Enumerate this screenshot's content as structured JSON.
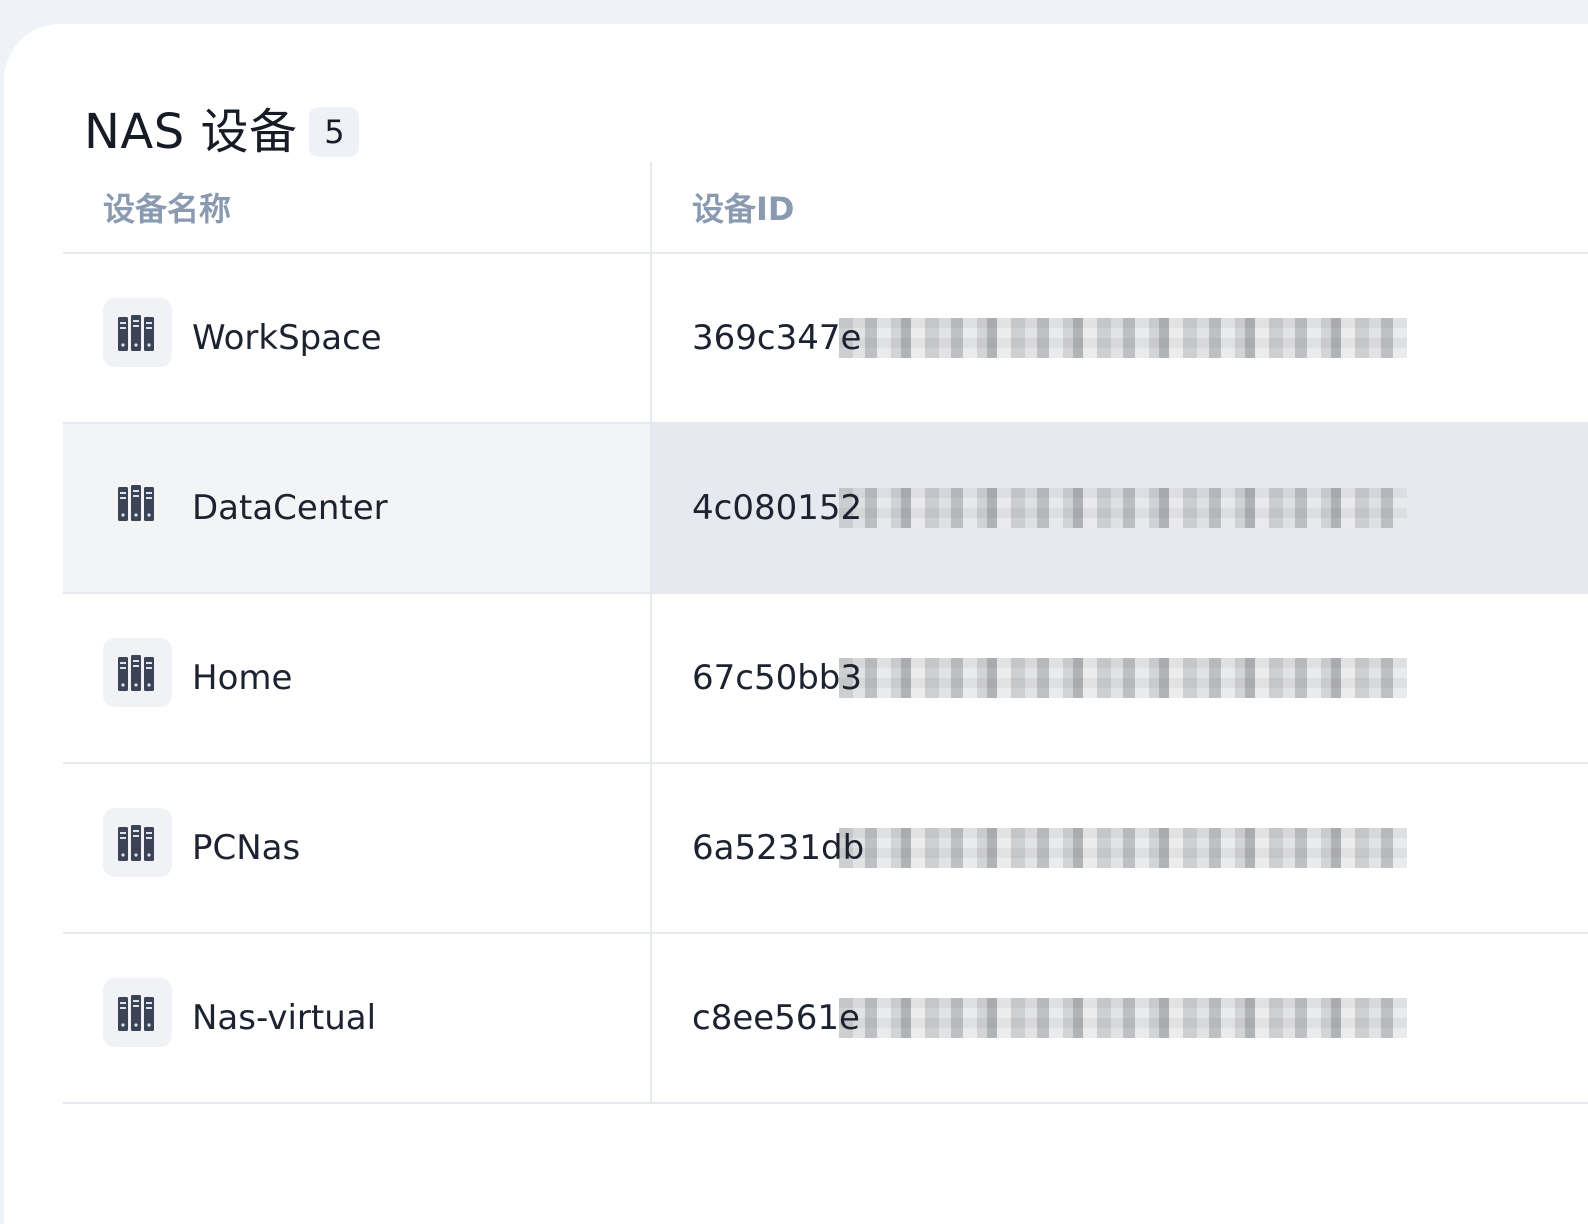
{
  "header": {
    "title": "NAS 设备",
    "count": "5"
  },
  "table": {
    "columns": [
      "设备名称",
      "设备ID"
    ],
    "rows": [
      {
        "name": "WorkSpace",
        "device_id": "369c347e",
        "icon": "server-rack-icon"
      },
      {
        "name": "DataCenter",
        "device_id": "4c080152",
        "icon": "server-rack-icon",
        "selected": true
      },
      {
        "name": "Home",
        "device_id": "67c50bb3",
        "icon": "server-rack-icon"
      },
      {
        "name": "PCNas",
        "device_id": "6a5231db",
        "icon": "server-rack-icon"
      },
      {
        "name": "Nas-virtual",
        "device_id": "c8ee561e",
        "icon": "server-rack-icon"
      }
    ]
  },
  "colors": {
    "background": "#eff2f6",
    "card": "#ffffff",
    "header_text": "#8a9ab0",
    "selected_row": "#f3f4f6",
    "icon": "#3c4356"
  }
}
